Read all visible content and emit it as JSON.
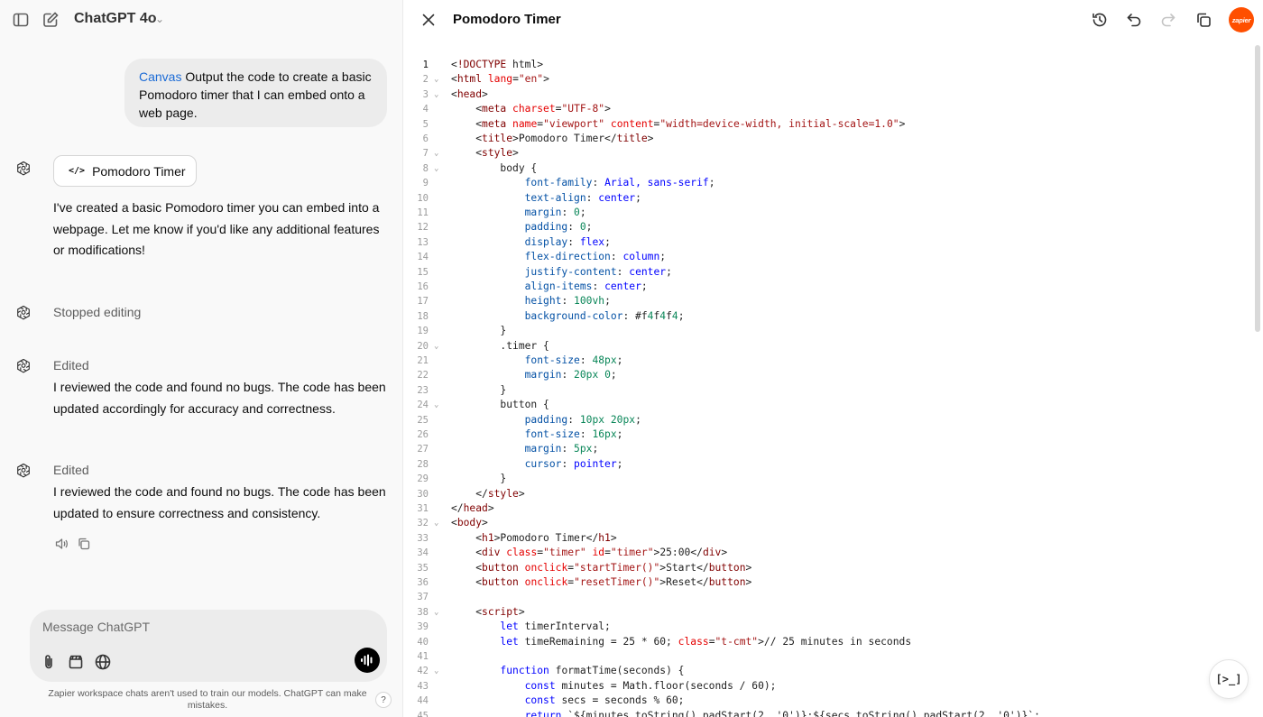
{
  "header": {
    "model_name": "ChatGPT 4o"
  },
  "chat": {
    "user_message_prefix": "Canvas",
    "user_message": " Output the code to create a basic Pomodoro timer that I can embed onto a web page.",
    "canvas_chip_label": "Pomodoro Timer",
    "assistant_message_1": "I've created a basic Pomodoro timer you can embed into a webpage. Let me know if you'd like any additional features or modifications!",
    "status_stopped": "Stopped editing",
    "status_edited_1": "Edited",
    "assistant_message_2": "I reviewed the code and found no bugs. The code has been updated accordingly for accuracy and correctness.",
    "status_edited_2": "Edited",
    "assistant_message_3": "I reviewed the code and found no bugs. The code has been updated to ensure correctness and consistency."
  },
  "composer": {
    "placeholder": "Message ChatGPT"
  },
  "footer": {
    "disclaimer": "Zapier workspace chats aren't used to train our models. ChatGPT can make mistakes.",
    "help_label": "?"
  },
  "canvas": {
    "title": "Pomodoro Timer",
    "avatar_label": "zapier",
    "run_label": "[>_]",
    "code_lines": [
      {
        "n": "1",
        "fold": "",
        "code": "<!DOCTYPE html>"
      },
      {
        "n": "2",
        "fold": "⌄",
        "code": "<html lang=\"en\">"
      },
      {
        "n": "3",
        "fold": "⌄",
        "code": "<head>"
      },
      {
        "n": "4",
        "fold": "",
        "code": "    <meta charset=\"UTF-8\">"
      },
      {
        "n": "5",
        "fold": "",
        "code": "    <meta name=\"viewport\" content=\"width=device-width, initial-scale=1.0\">"
      },
      {
        "n": "6",
        "fold": "",
        "code": "    <title>Pomodoro Timer</title>"
      },
      {
        "n": "7",
        "fold": "⌄",
        "code": "    <style>"
      },
      {
        "n": "8",
        "fold": "⌄",
        "code": "        body {"
      },
      {
        "n": "9",
        "fold": "",
        "code": "            font-family: Arial, sans-serif;"
      },
      {
        "n": "10",
        "fold": "",
        "code": "            text-align: center;"
      },
      {
        "n": "11",
        "fold": "",
        "code": "            margin: 0;"
      },
      {
        "n": "12",
        "fold": "",
        "code": "            padding: 0;"
      },
      {
        "n": "13",
        "fold": "",
        "code": "            display: flex;"
      },
      {
        "n": "14",
        "fold": "",
        "code": "            flex-direction: column;"
      },
      {
        "n": "15",
        "fold": "",
        "code": "            justify-content: center;"
      },
      {
        "n": "16",
        "fold": "",
        "code": "            align-items: center;"
      },
      {
        "n": "17",
        "fold": "",
        "code": "            height: 100vh;"
      },
      {
        "n": "18",
        "fold": "",
        "code": "            background-color: #f4f4f4;"
      },
      {
        "n": "19",
        "fold": "",
        "code": "        }"
      },
      {
        "n": "20",
        "fold": "⌄",
        "code": "        .timer {"
      },
      {
        "n": "21",
        "fold": "",
        "code": "            font-size: 48px;"
      },
      {
        "n": "22",
        "fold": "",
        "code": "            margin: 20px 0;"
      },
      {
        "n": "23",
        "fold": "",
        "code": "        }"
      },
      {
        "n": "24",
        "fold": "⌄",
        "code": "        button {"
      },
      {
        "n": "25",
        "fold": "",
        "code": "            padding: 10px 20px;"
      },
      {
        "n": "26",
        "fold": "",
        "code": "            font-size: 16px;"
      },
      {
        "n": "27",
        "fold": "",
        "code": "            margin: 5px;"
      },
      {
        "n": "28",
        "fold": "",
        "code": "            cursor: pointer;"
      },
      {
        "n": "29",
        "fold": "",
        "code": "        }"
      },
      {
        "n": "30",
        "fold": "",
        "code": "    </style>"
      },
      {
        "n": "31",
        "fold": "",
        "code": "</head>"
      },
      {
        "n": "32",
        "fold": "⌄",
        "code": "<body>"
      },
      {
        "n": "33",
        "fold": "",
        "code": "    <h1>Pomodoro Timer</h1>"
      },
      {
        "n": "34",
        "fold": "",
        "code": "    <div class=\"timer\" id=\"timer\">25:00</div>"
      },
      {
        "n": "35",
        "fold": "",
        "code": "    <button onclick=\"startTimer()\">Start</button>"
      },
      {
        "n": "36",
        "fold": "",
        "code": "    <button onclick=\"resetTimer()\">Reset</button>"
      },
      {
        "n": "37",
        "fold": "",
        "code": ""
      },
      {
        "n": "38",
        "fold": "⌄",
        "code": "    <script>"
      },
      {
        "n": "39",
        "fold": "",
        "code": "        let timerInterval;"
      },
      {
        "n": "40",
        "fold": "",
        "code": "        let timeRemaining = 25 * 60; // 25 minutes in seconds"
      },
      {
        "n": "41",
        "fold": "",
        "code": ""
      },
      {
        "n": "42",
        "fold": "⌄",
        "code": "        function formatTime(seconds) {"
      },
      {
        "n": "43",
        "fold": "",
        "code": "            const minutes = Math.floor(seconds / 60);"
      },
      {
        "n": "44",
        "fold": "",
        "code": "            const secs = seconds % 60;"
      },
      {
        "n": "45",
        "fold": "",
        "code": "            return `${minutes.toString().padStart(2, '0')}:${secs.toString().padStart(2, '0')}`;"
      }
    ]
  }
}
